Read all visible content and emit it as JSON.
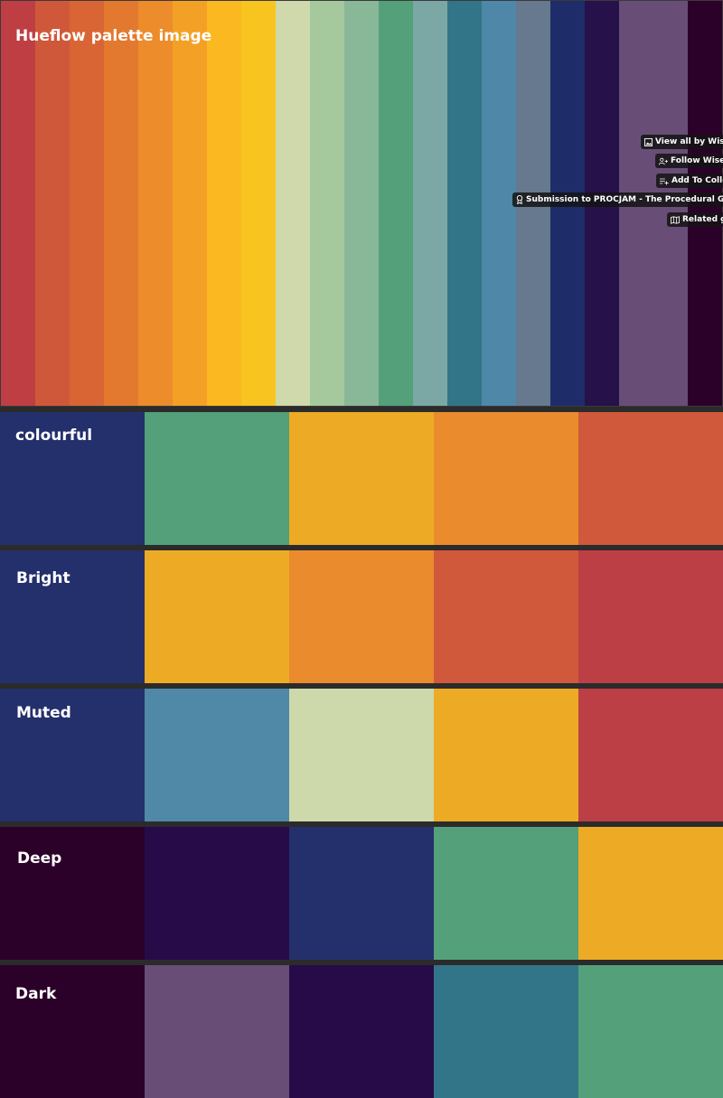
{
  "hero": {
    "title": "Hueflow palette image",
    "stripes": [
      "#be3e44",
      "#d0583a",
      "#d96535",
      "#e3792f",
      "#ec8c2b",
      "#f3a126",
      "#fbb821",
      "#f8c520",
      "#cfd9ab",
      "#a5c99c",
      "#89b899",
      "#54a07b",
      "#7ba8a4",
      "#337588",
      "#4e87a8",
      "#66798f",
      "#1f2c6a",
      "#27114a",
      "#684e76",
      "#2b0029"
    ],
    "toolbar": [
      {
        "label": "View all by Wiseda",
        "icon": "image-icon"
      },
      {
        "label": "Follow Wiseda",
        "icon": "user-plus-icon"
      },
      {
        "label": "Add To Collect",
        "icon": "playlist-add-icon"
      },
      {
        "label": "Submission to PROCJAM - The Procedural Generation J",
        "icon": "award-icon"
      },
      {
        "label": "Related gam",
        "icon": "map-icon"
      }
    ]
  },
  "palettes": [
    {
      "name": "colourful",
      "colors": [
        "#23306b",
        "#54a07a",
        "#edab25",
        "#ea8c2e",
        "#d0593b"
      ]
    },
    {
      "name": "Bright",
      "colors": [
        "#23306b",
        "#edab25",
        "#ea8c2e",
        "#d0593b",
        "#bc3f45"
      ]
    },
    {
      "name": "Muted",
      "colors": [
        "#23306b",
        "#5088a8",
        "#cdd8ab",
        "#edab25",
        "#bc3f45"
      ]
    },
    {
      "name": "Deep",
      "colors": [
        "#2b0029",
        "#260b48",
        "#23306b",
        "#54a07a",
        "#edab25"
      ]
    },
    {
      "name": "Dark",
      "colors": [
        "#2b0029",
        "#684e76",
        "#260b48",
        "#337588",
        "#54a07a"
      ]
    }
  ]
}
